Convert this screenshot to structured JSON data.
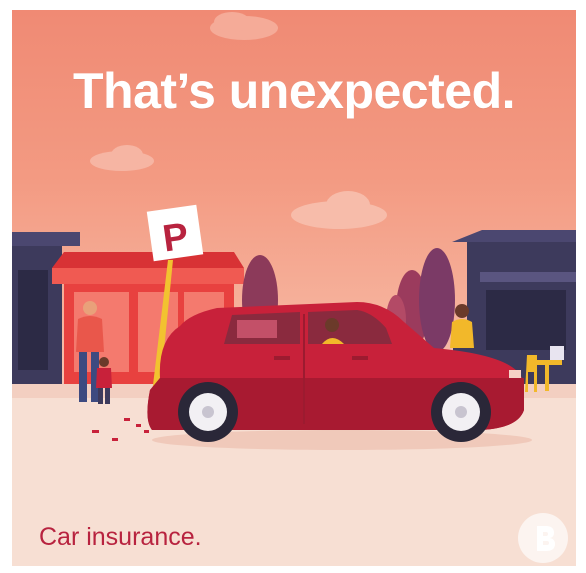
{
  "ad": {
    "headline": "That’s unexpected.",
    "tagline": "Car insurance.",
    "sign_letter": "P"
  },
  "colors": {
    "headline_text": "#ffffff",
    "tagline_text": "#b8233f",
    "car_body": "#c8213a",
    "sky_top": "#f08a74",
    "ground": "#f7dfd3",
    "building_dark": "#3d3a5c",
    "shop_red": "#e8413f",
    "sign_post": "#f2c230"
  },
  "icons": {
    "logo": "brand-b-logo-icon"
  }
}
